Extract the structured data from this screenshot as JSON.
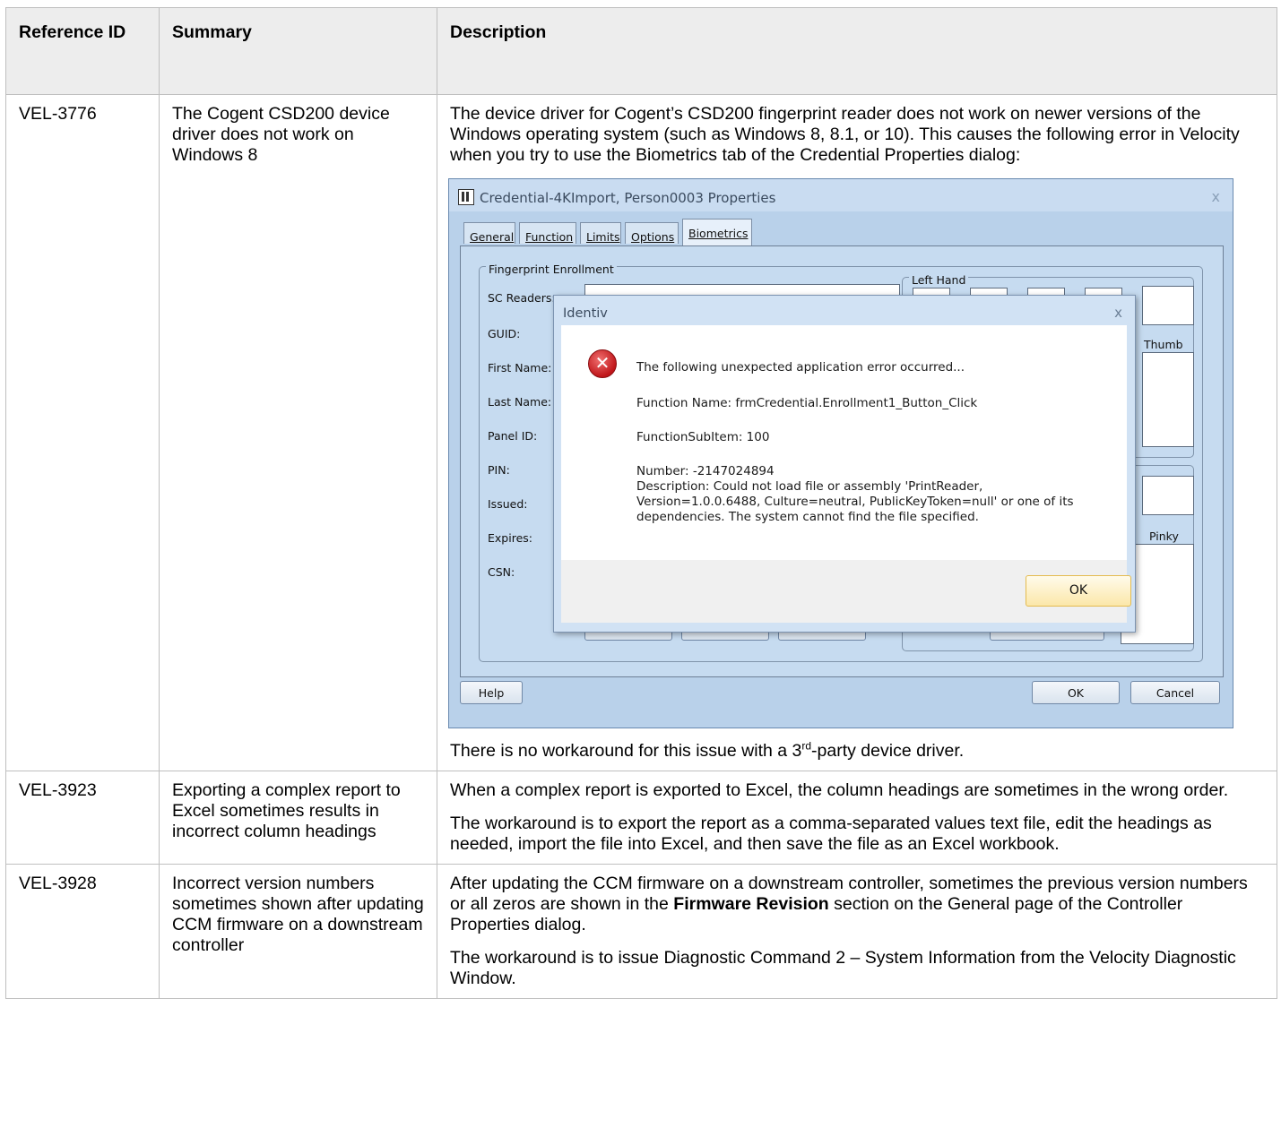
{
  "table": {
    "headers": [
      "Reference ID",
      "Summary",
      "Description"
    ],
    "rows": [
      {
        "id": "VEL-3776",
        "summary": "The Cogent CSD200 device driver does not work on Windows 8",
        "description_p1": "The device driver for Cogent’s CSD200 fingerprint reader does not work on newer versions of the Windows operating system (such as Windows 8, 8.1, or 10).  This causes the following error in Velocity when you try to use the Biometrics tab of the Credential Properties dialog:",
        "description_p2_before": "There is no workaround for this issue with a 3",
        "description_p2_sup": "rd",
        "description_p2_after": "-party device driver."
      },
      {
        "id": "VEL-3923",
        "summary": "Exporting a complex report to Excel sometimes results in incorrect column headings",
        "description_p1": "When a complex report is exported to Excel, the column headings are sometimes in the wrong order.",
        "description_p2": "The workaround is to export the report as a comma-separated values text file, edit the headings as needed, import the file into Excel, and then save the file as an Excel workbook."
      },
      {
        "id": "VEL-3928",
        "summary": "Incorrect version numbers sometimes shown after updating CCM firmware on a downstream controller",
        "description_p1_before": "After updating the CCM firmware on a downstream controller, sometimes the previous version numbers or all zeros are shown in the ",
        "description_p1_bold": "Firmware Revision",
        "description_p1_after": " section on the General page of the Controller Properties dialog.",
        "description_p2": "The workaround is to issue Diagnostic Command 2 – System Information from the Velocity Diagnostic Window."
      }
    ]
  },
  "screenshot": {
    "window_title": "Credential-4KImport, Person0003 Properties",
    "close_glyph": "x",
    "tabs": [
      "General",
      "Function",
      "Limits",
      "Options",
      "Biometrics"
    ],
    "group_enrollment": "Fingerprint Enrollment",
    "group_left_hand": "Left Hand",
    "fields": [
      "SC Readers:",
      "GUID:",
      "First Name:",
      "Last Name:",
      "Panel ID:",
      "PIN:",
      "Issued:",
      "Expires:",
      "CSN:"
    ],
    "thumb_label": "Thumb",
    "pinky_label": "Pinky",
    "help_button": "Help",
    "ok_button": "OK",
    "cancel_button": "Cancel",
    "error_dialog": {
      "title": "Identiv",
      "close_glyph": "x",
      "icon_glyph": "✕",
      "line1": "The following unexpected application error occurred...",
      "line2": "Function Name: frmCredential.Enrollment1_Button_Click",
      "line3": "FunctionSubItem: 100",
      "line4": "Number: -2147024894",
      "line5": "Description: Could not load file or assembly 'PrintReader,",
      "line6": "Version=1.0.0.6488, Culture=neutral, PublicKeyToken=null' or one of its",
      "line7": "dependencies. The system cannot find the file specified.",
      "ok_button": "OK"
    }
  }
}
